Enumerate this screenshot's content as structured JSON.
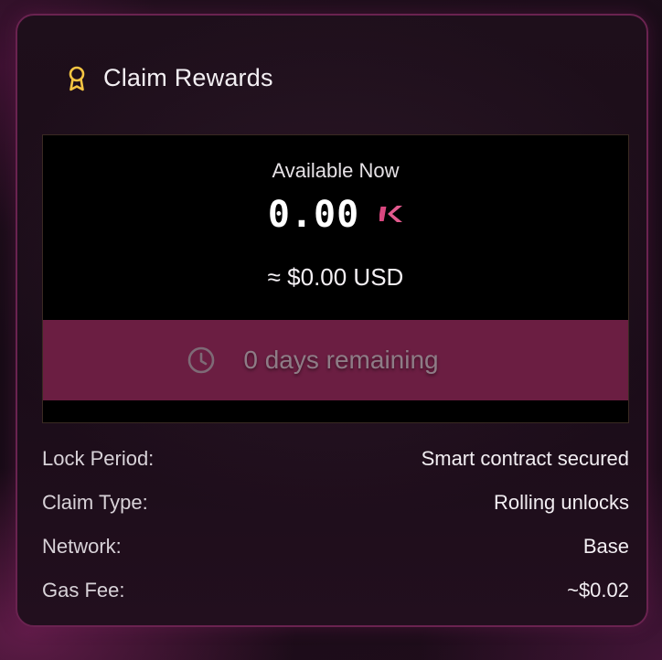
{
  "card": {
    "title": "Claim Rewards",
    "title_icon": "award-ribbon-icon",
    "accent_color": "#f5c542",
    "border_color": "#6a2350"
  },
  "claim": {
    "available_label": "Available Now",
    "amount": "0.00",
    "token_icon": "token-k-logo-icon",
    "token_color": "#d9477f",
    "usd_value": "≈ $0.00 USD",
    "timer_icon": "clock-icon",
    "remaining_text": "0 days remaining",
    "timer_bar_color": "#6b1e42"
  },
  "details": [
    {
      "label": "Lock Period:",
      "value": "Smart contract secured"
    },
    {
      "label": "Claim Type:",
      "value": "Rolling unlocks"
    },
    {
      "label": "Network:",
      "value": "Base"
    },
    {
      "label": "Gas Fee:",
      "value": "~$0.02"
    }
  ]
}
